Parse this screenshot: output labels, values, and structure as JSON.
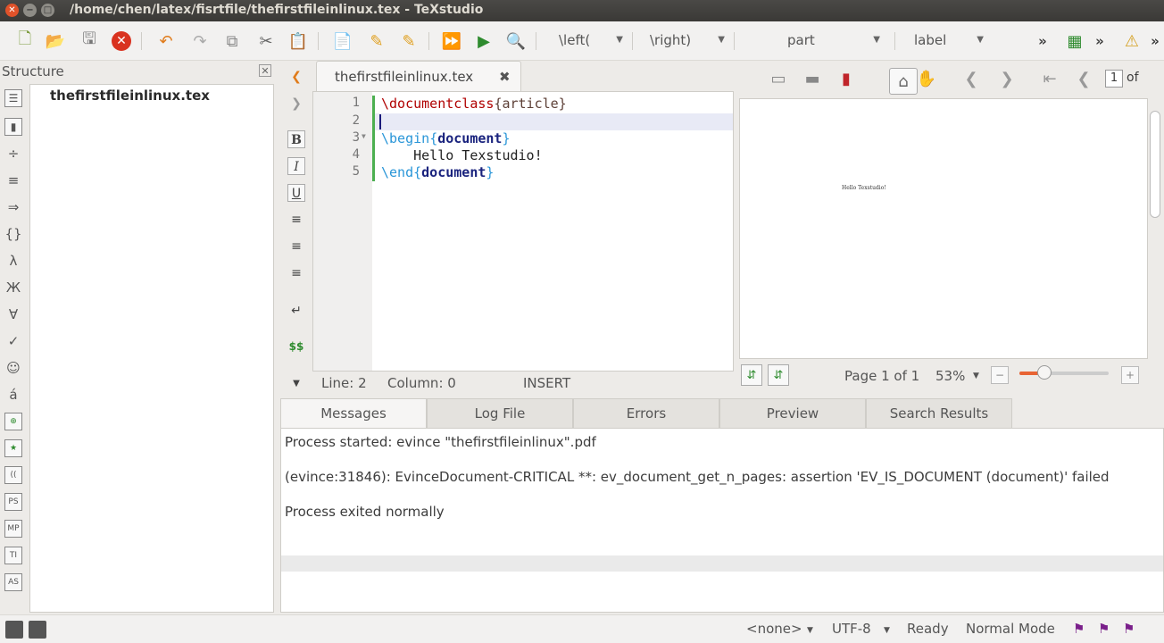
{
  "window": {
    "title": "/home/chen/latex/fisrtfile/thefirstfileinlinux.tex - TeXstudio"
  },
  "toolbar": {
    "left_combo": "\\left(",
    "right_combo": "\\right)",
    "part_combo": "part",
    "label_combo": "label",
    "more": "»",
    "more2": "»",
    "more3": "»"
  },
  "structure": {
    "header": "Structure",
    "file": "thefirstfileinlinux.tex",
    "symbol_glyphs": [
      "÷",
      "≡",
      "⇒",
      "{}",
      "λ",
      "Ж",
      "∀",
      "✓",
      "☺",
      "á"
    ],
    "symbol_boxes": [
      "⊕",
      "★",
      "((",
      "PS",
      "MP",
      "TI",
      "AS"
    ]
  },
  "editor": {
    "tab_name": "thefirstfileinlinux.tex",
    "tab_close": "✖",
    "line_numbers": [
      "1",
      "2",
      "3",
      "4",
      "5"
    ],
    "lines": {
      "l1_cmd": "\\documentclass",
      "l1_arg": "{article}",
      "l3_cmd": "\\begin",
      "l3_arg": "document",
      "l4": "    Hello Texstudio!",
      "l5_cmd": "\\end",
      "l5_arg": "document"
    },
    "status": {
      "line": "Line: 2",
      "column": "Column: 0",
      "mode": "INSERT"
    },
    "fmt": [
      "B",
      "I",
      "U",
      "$$"
    ]
  },
  "pdf": {
    "hello": "Hello Texstudio!",
    "page_box": "1",
    "page_of": "of",
    "page_status": "Page 1 of 1",
    "zoom": "53%",
    "zoom_level": 0.28
  },
  "messages": {
    "tabs": [
      "Messages",
      "Log File",
      "Errors",
      "Preview",
      "Search Results"
    ],
    "lines": [
      "Process started: evince \"thefirstfileinlinux\".pdf",
      "(evince:31846): EvinceDocument-CRITICAL **: ev_document_get_n_pages: assertion 'EV_IS_DOCUMENT (document)' failed",
      "Process exited normally"
    ]
  },
  "statusbar": {
    "none": "<none>",
    "encoding": "UTF-8",
    "ready": "Ready",
    "mode": "Normal Mode"
  },
  "colors": {
    "accent_green": "#2e8b2e",
    "close_red": "#d9321f",
    "keyword_blue": "#2a96d8"
  }
}
